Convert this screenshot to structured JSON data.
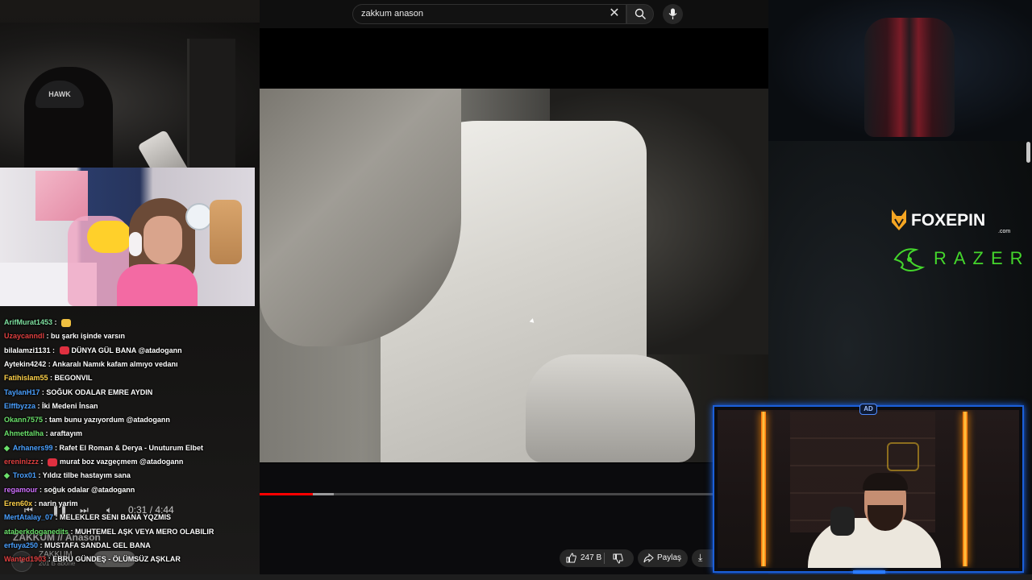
{
  "search": {
    "query": "zakkum anason",
    "clear_icon": "close-icon",
    "search_icon": "search-icon",
    "mic_icon": "microphone-icon"
  },
  "player": {
    "progress": 0.117,
    "buffered": 0.045,
    "time": "0:31 / 4:44",
    "accent_color": "#ff0000"
  },
  "video": {
    "title": "ZAKKUM // Anason",
    "channel_name": "ZAKKUM",
    "subscribers": "201 B abone",
    "like_count": "247 B",
    "share_label": "Paylaş"
  },
  "chat": [
    {
      "user": "ArifMurat1453",
      "color": "#7fe0a0",
      "message": "",
      "emote": true,
      "emote_color": "#f0c040",
      "diamond": false
    },
    {
      "user": "Uzaycanndl",
      "color": "#e04040",
      "message": "bu şarkı işinde varsın",
      "emote": false,
      "diamond": false
    },
    {
      "user": "bilalamzi1131",
      "color": "#ffffff",
      "message": "DÜNYA GÜL BANA @atadogann",
      "emote": true,
      "emote_color": "#e03040",
      "diamond": false
    },
    {
      "user": "Aytekin4242",
      "color": "#ffffff",
      "message": "Ankaralı Namık kafam almıyo vedanı",
      "emote": false,
      "diamond": false
    },
    {
      "user": "Fatihislam55",
      "color": "#ffd24a",
      "message": "BEGONVIL",
      "emote": false,
      "diamond": false
    },
    {
      "user": "TaylanH17",
      "color": "#4aa0ff",
      "message": "SOĞUK ODALAR EMRE AYDIN",
      "emote": false,
      "diamond": false
    },
    {
      "user": "Elffbyzza",
      "color": "#4aa0ff",
      "message": "İki Medeni İnsan",
      "emote": false,
      "diamond": false
    },
    {
      "user": "Okann7575",
      "color": "#6be06b",
      "message": "tam bunu yazıyordum @atadogann",
      "emote": false,
      "diamond": false
    },
    {
      "user": "Ahmettalha",
      "color": "#6be06b",
      "message": "araftayım",
      "emote": false,
      "diamond": false
    },
    {
      "user": "Arhaners99",
      "color": "#4aa0ff",
      "message": "Rafet El Roman & Derya - Unuturum Elbet",
      "emote": false,
      "diamond": true
    },
    {
      "user": "ereninizzz",
      "color": "#e04040",
      "message": "murat boz vazgeçmem @atadogann",
      "emote": true,
      "emote_color": "#e03040",
      "diamond": false
    },
    {
      "user": "Trox01",
      "color": "#4aa0ff",
      "message": "Yıldız tilbe hastayım sana",
      "emote": false,
      "diamond": true
    },
    {
      "user": "regamour",
      "color": "#d070ff",
      "message": "soğuk odalar @atadogann",
      "emote": false,
      "diamond": false
    },
    {
      "user": "Eren60x",
      "color": "#ffd24a",
      "message": "narin yarim",
      "emote": false,
      "diamond": false
    },
    {
      "user": "MertAtalay_07",
      "color": "#4aa0ff",
      "message": "MELEKLER SENI BANA YQZMIS",
      "emote": false,
      "diamond": false
    },
    {
      "user": "ataberkdoganedits",
      "color": "#6be06b",
      "message": "MUHTEMEL AŞK VEYA MERO OLABILIR",
      "emote": false,
      "diamond": false
    },
    {
      "user": "erfuya250",
      "color": "#4aa0ff",
      "message": "MUSTAFA SANDAL GEL BANA",
      "emote": false,
      "diamond": false
    },
    {
      "user": "Wanted1903",
      "color": "#e04040",
      "message": "EBRU GÜNDEŞ - ÖLÜMSÜZ AŞKLAR",
      "emote": false,
      "diamond": false
    }
  ],
  "sponsors": {
    "fox_name": "FOXEPIN",
    "fox_domain": ".com",
    "razer_name": "RAZER"
  },
  "webcam": {
    "badge": "AD",
    "cap_text": "HAWK",
    "frame_color": "#1b5fd9",
    "neon_color": "#ff8a00"
  }
}
